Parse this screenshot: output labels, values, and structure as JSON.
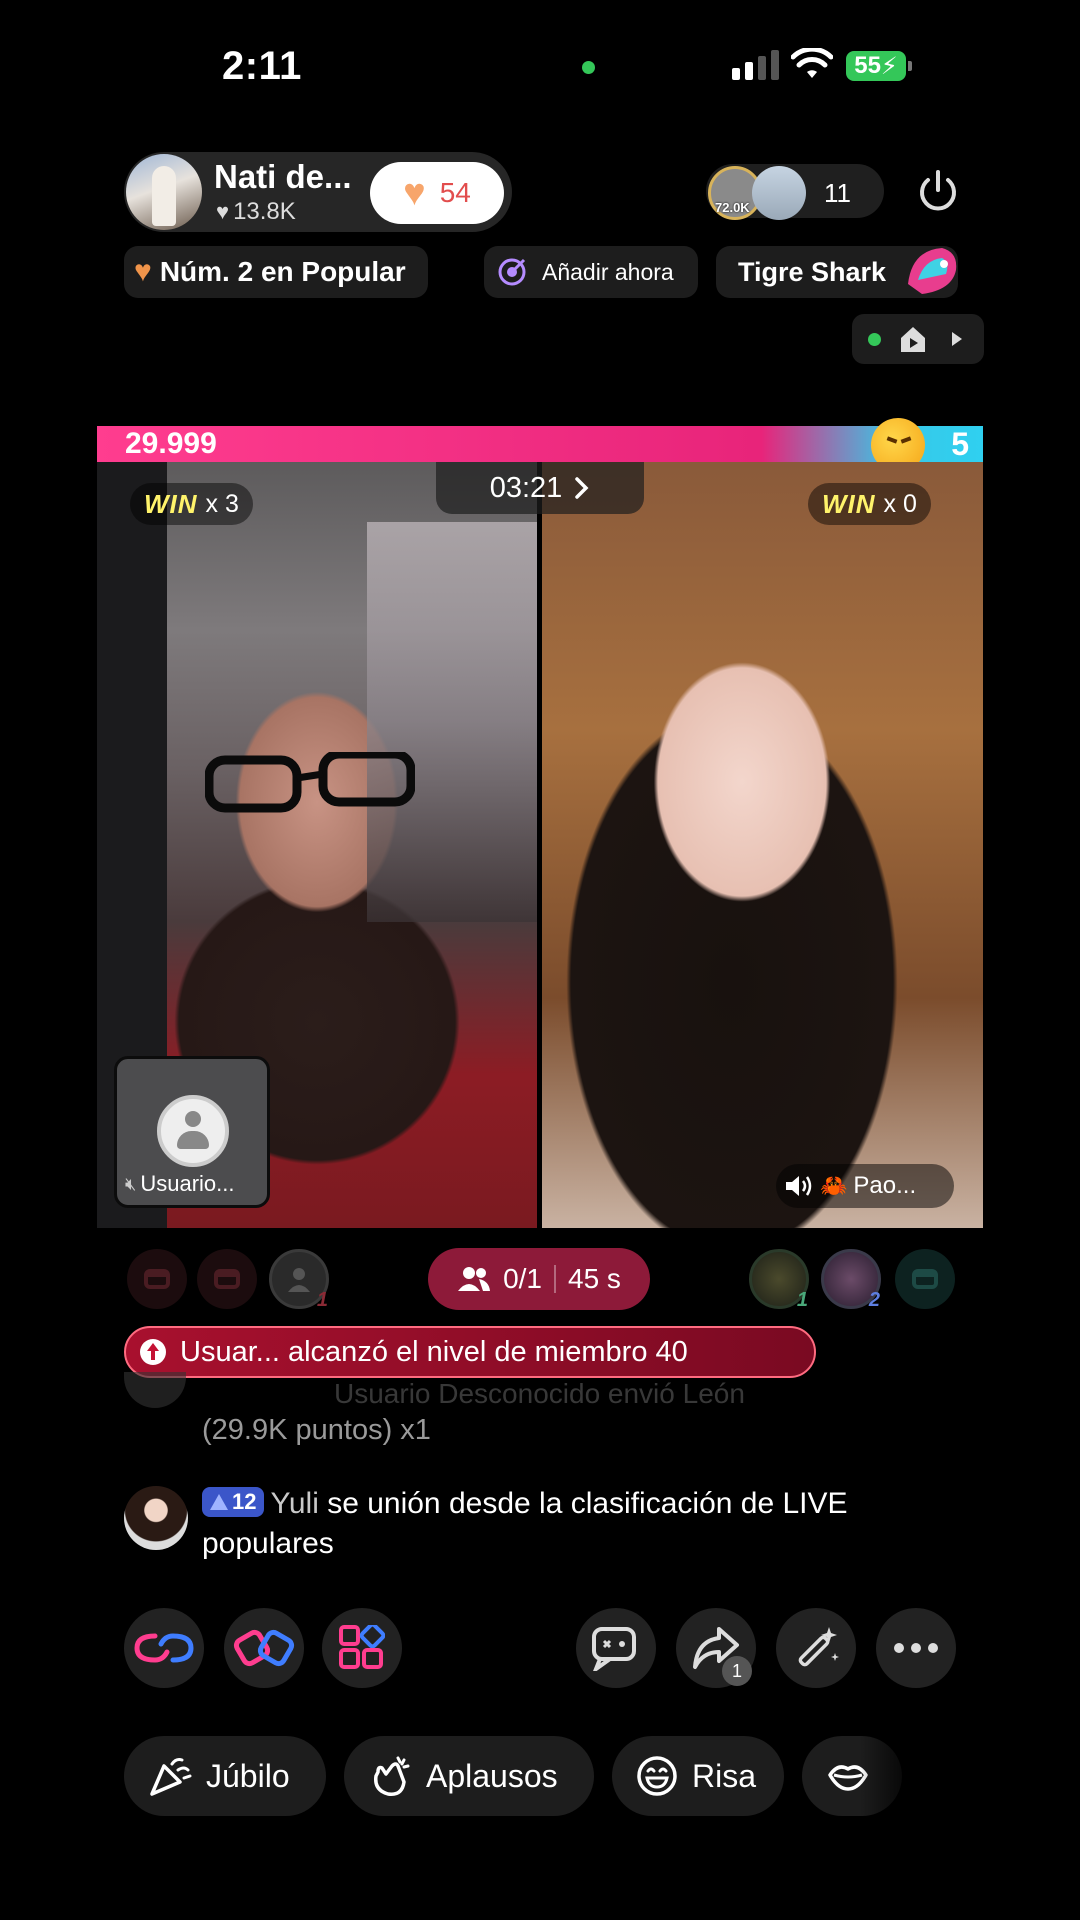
{
  "status_bar": {
    "time": "2:11",
    "battery": "55"
  },
  "host": {
    "name": "Nati de...",
    "likes": "13.8K",
    "fan_count": "54"
  },
  "viewers": {
    "avatar_level": "72.0K",
    "count": "11"
  },
  "chips": {
    "popular": "Núm. 2 en Popular",
    "add": "Añadir ahora",
    "gift": "Tigre Shark"
  },
  "battle": {
    "score_left": "29.999",
    "score_right": "5",
    "timer": "03:21",
    "win_label": "WIN",
    "win_left": "x 3",
    "win_right": "x 0",
    "guest_left_name": "Usuario...",
    "guest_right_name": "Pao..."
  },
  "seats": {
    "left_user_num": "1",
    "right_num_1": "1",
    "right_num_2": "2",
    "guest_count": "0/1",
    "countdown": "45 s"
  },
  "feed": {
    "level_banner": "Usuar... alcanzó el nivel de miembro 40",
    "faded_line": "Usuario Desconocido envió León",
    "points_line": "(29.9K puntos) x1",
    "chat_level": "12",
    "chat_user": "Yuli",
    "chat_message": " se unión desde la clasificación de LIVE populares"
  },
  "actions": {
    "share_count": "1"
  },
  "reactions": {
    "jubilo": "Júbilo",
    "aplausos": "Aplausos",
    "risa": "Risa"
  },
  "colors": {
    "accent_pink": "#ff3d8f",
    "accent_blue": "#2fd0f0",
    "banner_red": "#a8102e",
    "guest_pill": "#8d1a39"
  }
}
